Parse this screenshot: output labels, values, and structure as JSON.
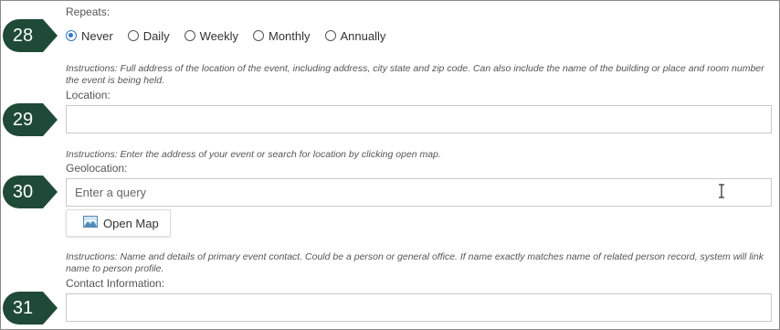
{
  "repeats": {
    "label": "Repeats:",
    "options": [
      "Never",
      "Daily",
      "Weekly",
      "Monthly",
      "Annually"
    ],
    "selected": "Never"
  },
  "location": {
    "instructions": "Instructions: Full address of the location of the event, including address, city state and zip code. Can also include the name of the building or place and room number the event is being held.",
    "label": "Location:",
    "value": ""
  },
  "geolocation": {
    "instructions": "Instructions: Enter the address of your event or search for location by clicking open map.",
    "label": "Geolocation:",
    "placeholder": "Enter a query",
    "open_map_label": "Open Map"
  },
  "contact": {
    "instructions": "Instructions: Name and details of primary event contact. Could be a person or general office. If name exactly matches name of related person record, system will link name to person profile.",
    "label": "Contact Information:",
    "value": ""
  },
  "step_badges": [
    "28",
    "29",
    "30",
    "31"
  ],
  "colors": {
    "badge": "#1f4a38",
    "radio_accent": "#2c7cc4",
    "field_border": "#c9c9c9"
  },
  "icons": {
    "map_button": "map-image-icon",
    "cursor": "text-cursor-icon"
  }
}
